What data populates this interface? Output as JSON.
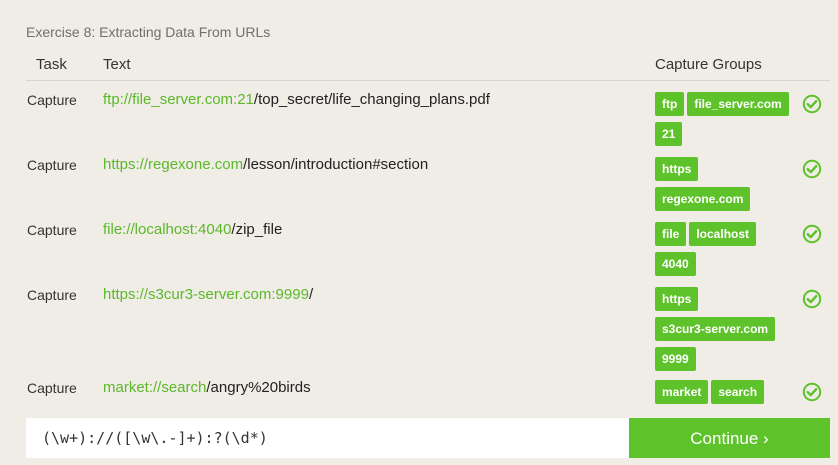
{
  "exercise": {
    "title": "Exercise 8: Extracting Data From URLs"
  },
  "table": {
    "headers": {
      "task": "Task",
      "text": "Text",
      "groups": "Capture Groups"
    },
    "rows": [
      {
        "task": "Capture",
        "matched": "ftp://file_server.com:21",
        "rest": "/top_secret/life_changing_plans.pdf",
        "groups": [
          "ftp",
          "file_server.com",
          "21"
        ]
      },
      {
        "task": "Capture",
        "matched": "https://regexone.com",
        "rest": "/lesson/introduction#section",
        "groups": [
          "https",
          "regexone.com"
        ]
      },
      {
        "task": "Capture",
        "matched": "file://localhost:4040",
        "rest": "/zip_file",
        "groups": [
          "file",
          "localhost",
          "4040"
        ]
      },
      {
        "task": "Capture",
        "matched": "https://s3cur3-server.com:9999",
        "rest": "/",
        "groups": [
          "https",
          "s3cur3-server.com",
          "9999"
        ]
      },
      {
        "task": "Capture",
        "matched": "market://search",
        "rest": "/angry%20birds",
        "groups": [
          "market",
          "search"
        ]
      }
    ]
  },
  "regex_input": {
    "value": "(\\w+)://([\\w\\.-]+):?(\\d*)"
  },
  "continue_button": {
    "label": "Continue ›"
  },
  "colors": {
    "accent": "#5ec22b",
    "match_text": "#5cb82a",
    "background": "#efede6"
  },
  "icons": {
    "row_status": "check-circle-icon"
  }
}
